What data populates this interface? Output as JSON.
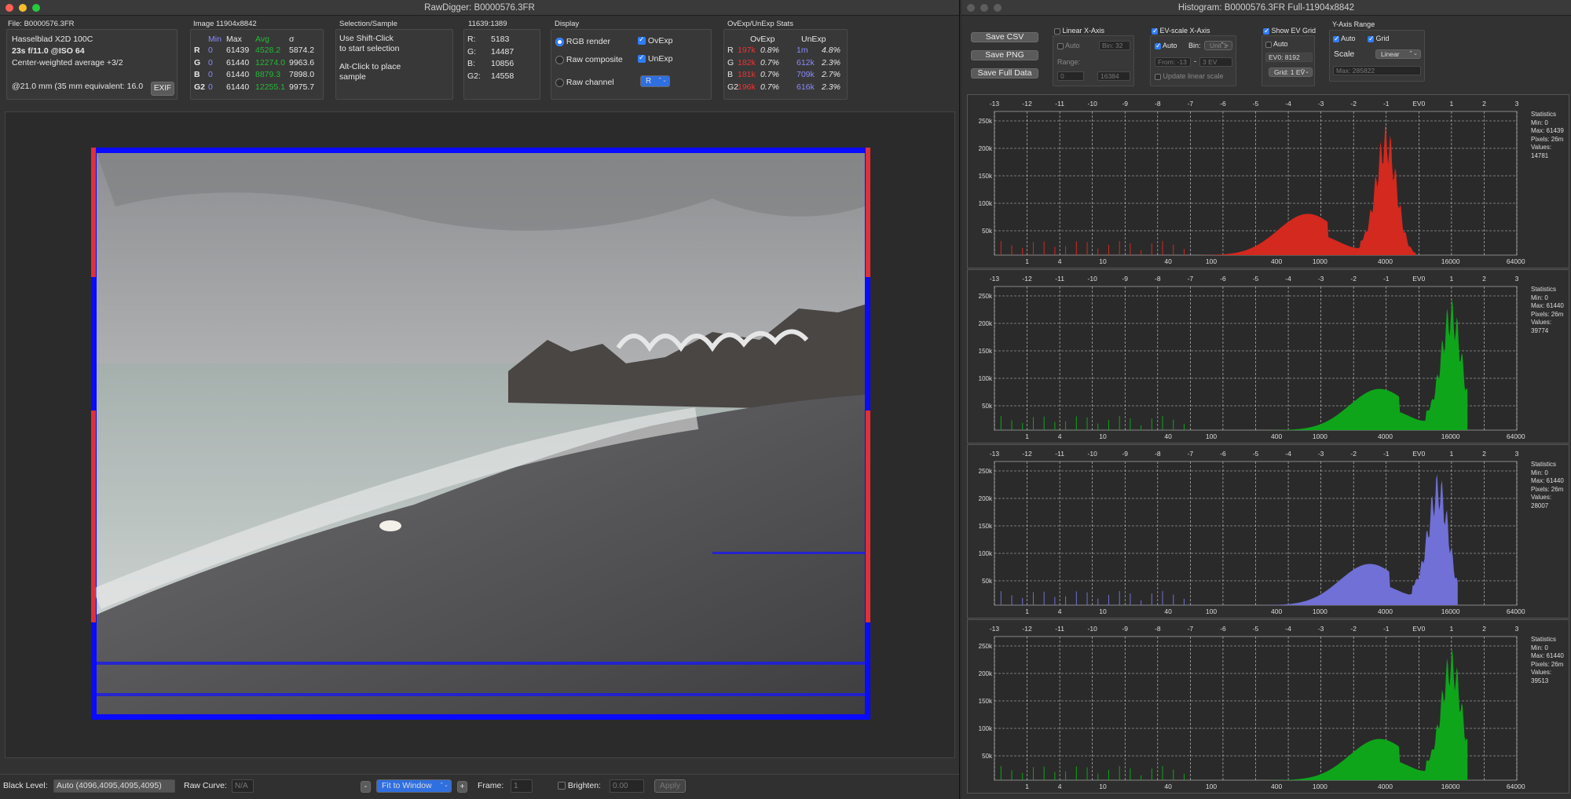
{
  "left_window": {
    "title": "RawDigger: B0000576.3FR",
    "file_panel": {
      "label": "File: B0000576.3FR",
      "camera": "Hasselblad X2D 100C",
      "exposure": "23s f/11.0 @ISO 64",
      "metering": "Center-weighted average +3/2",
      "focal": "@21.0 mm (35 mm equivalent: 16.0",
      "exif_button": "EXIF"
    },
    "image_panel": {
      "label": "Image 11904x8842",
      "headers": [
        "Min",
        "Max",
        "Avg",
        "σ"
      ],
      "rows": [
        {
          "ch": "R",
          "min": "0",
          "max": "61439",
          "avg": "4528.2",
          "sigma": "5874.2"
        },
        {
          "ch": "G",
          "min": "0",
          "max": "61440",
          "avg": "12274.0",
          "sigma": "9963.6"
        },
        {
          "ch": "B",
          "min": "0",
          "max": "61440",
          "avg": "8879.3",
          "sigma": "7898.0"
        },
        {
          "ch": "G2",
          "min": "0",
          "max": "61440",
          "avg": "12255.1",
          "sigma": "9975.7"
        }
      ]
    },
    "selection_panel": {
      "label": "Selection/Sample",
      "line1": "Use Shift-Click",
      "line2": "to start selection",
      "line3": "Alt-Click to place",
      "line4": "sample"
    },
    "coords_panel": {
      "label": "11639:1389",
      "rows": [
        {
          "ch": "R:",
          "val": "5183"
        },
        {
          "ch": "G:",
          "val": "14487"
        },
        {
          "ch": "B:",
          "val": "10856"
        },
        {
          "ch": "G2:",
          "val": "14558"
        }
      ]
    },
    "display_panel": {
      "label": "Display",
      "rgb_render": "RGB render",
      "raw_composite": "Raw composite",
      "raw_channel": "Raw channel",
      "ovexp": "OvExp",
      "unexp": "UnExp",
      "channel_value": "R"
    },
    "stats_panel": {
      "label": "OvExp/UnExp Stats",
      "headers": [
        "OvExp",
        "UnExp"
      ],
      "rows": [
        {
          "ch": "R",
          "ov_n": "197k",
          "ov_p": "0.8%",
          "un_n": "1m",
          "un_p": "4.8%"
        },
        {
          "ch": "G",
          "ov_n": "182k",
          "ov_p": "0.7%",
          "un_n": "612k",
          "un_p": "2.3%"
        },
        {
          "ch": "B",
          "ov_n": "181k",
          "ov_p": "0.7%",
          "un_n": "709k",
          "un_p": "2.7%"
        },
        {
          "ch": "G2",
          "ov_n": "196k",
          "ov_p": "0.7%",
          "un_n": "616k",
          "un_p": "2.3%"
        }
      ]
    },
    "bottom": {
      "black_level_label": "Black Level:",
      "black_level_value": "Auto (4096,4095,4095,4095)",
      "raw_curve_label": "Raw Curve:",
      "raw_curve_value": "N/A",
      "minus": "-",
      "fit": "Fit to Window",
      "plus": "+",
      "frame_label": "Frame:",
      "frame_value": "1",
      "brighten_label": "Brighten:",
      "brighten_value": "0.00",
      "apply": "Apply"
    }
  },
  "right_window": {
    "title": "Histogram: B0000576.3FR Full-11904x8842",
    "buttons": {
      "save_csv": "Save CSV",
      "save_png": "Save PNG",
      "save_full": "Save Full Data"
    },
    "linear_x": {
      "label": "Linear X-Axis",
      "auto": "Auto",
      "bin": "Bin: 32",
      "range": "Range:",
      "from": "0",
      "to": "16384"
    },
    "ev_x": {
      "label": "EV-scale X-Axis",
      "auto": "Auto",
      "bin_label": "Bin:",
      "bin_value": "Unit 1",
      "from": "From: -13",
      "dash": "-",
      "to": "3 EV",
      "update": "Update linear scale"
    },
    "ev_grid": {
      "label": "Show EV Grid",
      "auto": "Auto",
      "ev0": "EV0: 8192",
      "grid": "Grid: 1 EV"
    },
    "y_axis": {
      "label": "Y-Axis Range",
      "auto": "Auto",
      "grid": "Grid",
      "scale_label": "Scale",
      "scale_value": "Linear",
      "max": "Max: 285822"
    },
    "ev_ticks": [
      "-13",
      "-12",
      "-11",
      "-10",
      "-9",
      "-8",
      "-7",
      "-6",
      "-5",
      "-4",
      "-3",
      "-2",
      "-1",
      "EV0",
      "1",
      "2",
      "3"
    ],
    "x_ticks": [
      "1",
      "4",
      "10",
      "40",
      "100",
      "400",
      "1000",
      "4000",
      "16000",
      "64000"
    ],
    "y_ticks": [
      "250k",
      "200k",
      "150k",
      "100k",
      "50k"
    ],
    "colors": {
      "r": "#d4291e",
      "g": "#0ea51b",
      "b": "#7070d6"
    },
    "histograms": [
      {
        "channel": "R",
        "stats_title": "Statistics",
        "min": "Min: 0",
        "max": "Max: 61439",
        "pixels": "Pixels: 26m",
        "values": "Values: 14781"
      },
      {
        "channel": "G",
        "stats_title": "Statistics",
        "min": "Min: 0",
        "max": "Max: 61440",
        "pixels": "Pixels: 26m",
        "values": "Values: 39774"
      },
      {
        "channel": "B",
        "stats_title": "Statistics",
        "min": "Min: 0",
        "max": "Max: 61440",
        "pixels": "Pixels: 26m",
        "values": "Values: 28007"
      },
      {
        "channel": "G2",
        "stats_title": "Statistics",
        "min": "Min: 0",
        "max": "Max: 61440",
        "pixels": "Pixels: 26m",
        "values": "Values: 39513"
      }
    ]
  }
}
